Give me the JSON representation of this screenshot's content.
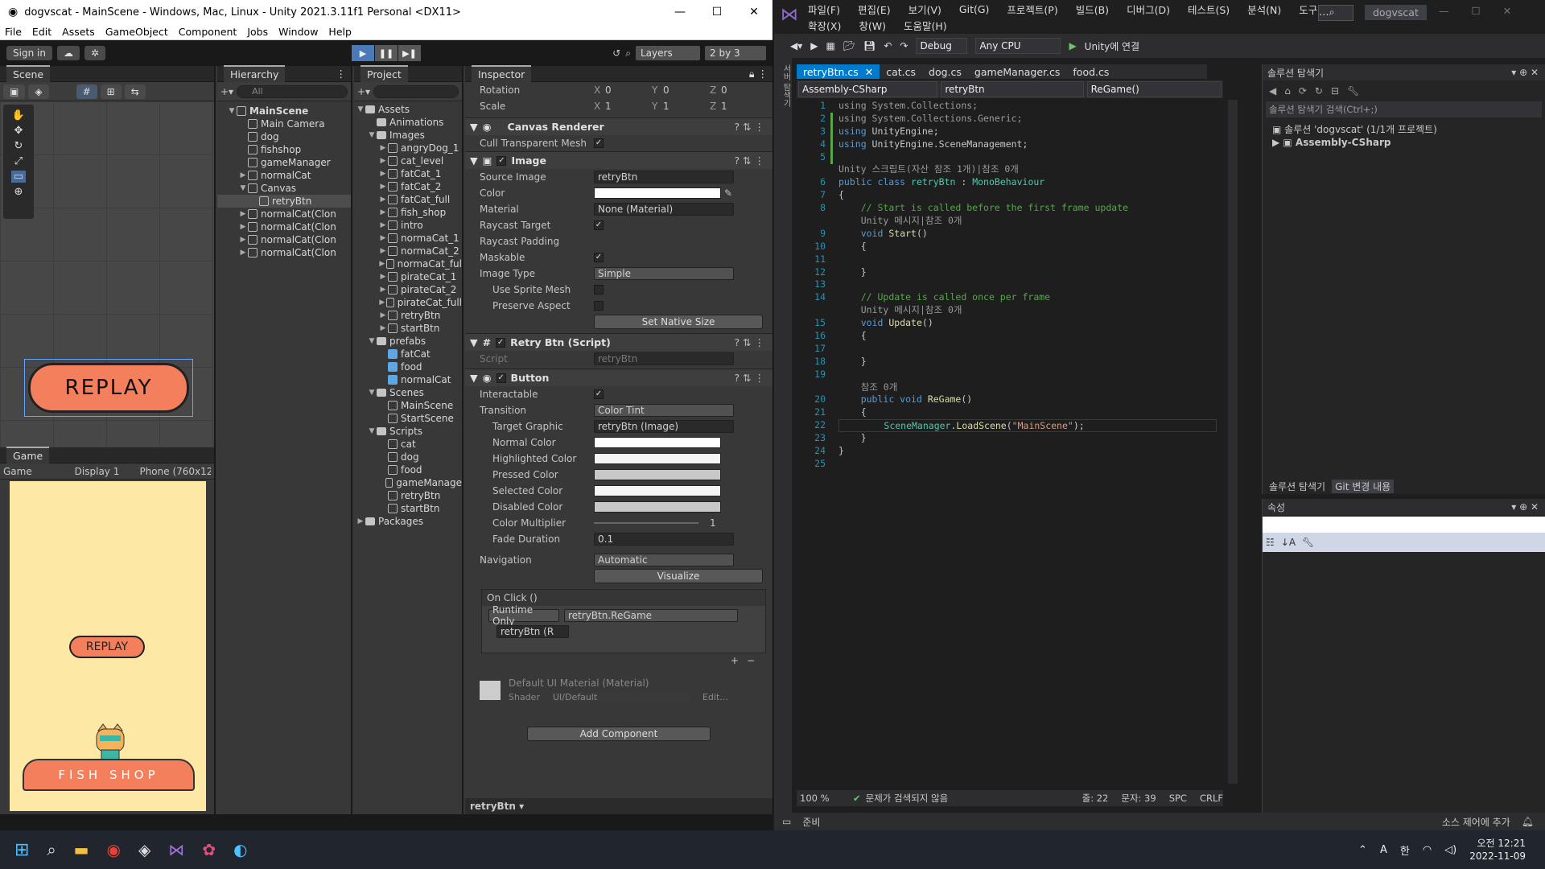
{
  "unity": {
    "title": "dogvscat - MainScene - Windows, Mac, Linux - Unity 2021.3.11f1 Personal <DX11>",
    "menu": [
      "File",
      "Edit",
      "Assets",
      "GameObject",
      "Component",
      "Jobs",
      "Window",
      "Help"
    ],
    "toolbar": {
      "signin": "Sign in",
      "layers": "Layers",
      "layout": "2 by 3"
    },
    "scene": {
      "tab": "Scene",
      "button_text": "REPLAY"
    },
    "game": {
      "tab": "Game",
      "display": "Game",
      "display_num": "Display 1",
      "resolution": "Phone (760x128",
      "replay": "REPLAY",
      "shop": "FISH  SHOP"
    },
    "hierarchy": {
      "tab": "Hierarchy",
      "search": "All",
      "items": [
        {
          "label": "MainScene",
          "depth": 0,
          "arrow": "▼",
          "bold": true
        },
        {
          "label": "Main Camera",
          "depth": 1,
          "arrow": ""
        },
        {
          "label": "dog",
          "depth": 1,
          "arrow": ""
        },
        {
          "label": "fishshop",
          "depth": 1,
          "arrow": ""
        },
        {
          "label": "gameManager",
          "depth": 1,
          "arrow": ""
        },
        {
          "label": "normalCat",
          "depth": 1,
          "arrow": "▶"
        },
        {
          "label": "Canvas",
          "depth": 1,
          "arrow": "▼"
        },
        {
          "label": "retryBtn",
          "depth": 2,
          "arrow": "",
          "selected": true
        },
        {
          "label": "normalCat(Clon",
          "depth": 1,
          "arrow": "▶"
        },
        {
          "label": "normalCat(Clon",
          "depth": 1,
          "arrow": "▶"
        },
        {
          "label": "normalCat(Clon",
          "depth": 1,
          "arrow": "▶"
        },
        {
          "label": "normalCat(Clon",
          "depth": 1,
          "arrow": "▶"
        }
      ]
    },
    "project": {
      "tab": "Project",
      "items": [
        {
          "label": "Assets",
          "depth": 0,
          "arrow": "▼",
          "type": "folder"
        },
        {
          "label": "Animations",
          "depth": 1,
          "arrow": "",
          "type": "folder"
        },
        {
          "label": "Images",
          "depth": 1,
          "arrow": "▼",
          "type": "folder"
        },
        {
          "label": "angryDog_1",
          "depth": 2,
          "arrow": "▶",
          "type": "img"
        },
        {
          "label": "cat_level",
          "depth": 2,
          "arrow": "▶",
          "type": "img"
        },
        {
          "label": "fatCat_1",
          "depth": 2,
          "arrow": "▶",
          "type": "img"
        },
        {
          "label": "fatCat_2",
          "depth": 2,
          "arrow": "▶",
          "type": "img"
        },
        {
          "label": "fatCat_full",
          "depth": 2,
          "arrow": "▶",
          "type": "img"
        },
        {
          "label": "fish_shop",
          "depth": 2,
          "arrow": "▶",
          "type": "img"
        },
        {
          "label": "intro",
          "depth": 2,
          "arrow": "▶",
          "type": "img"
        },
        {
          "label": "normaCat_1",
          "depth": 2,
          "arrow": "▶",
          "type": "img"
        },
        {
          "label": "normaCat_2",
          "depth": 2,
          "arrow": "▶",
          "type": "img"
        },
        {
          "label": "normaCat_ful",
          "depth": 2,
          "arrow": "▶",
          "type": "img"
        },
        {
          "label": "pirateCat_1",
          "depth": 2,
          "arrow": "▶",
          "type": "img"
        },
        {
          "label": "pirateCat_2",
          "depth": 2,
          "arrow": "▶",
          "type": "img"
        },
        {
          "label": "pirateCat_full",
          "depth": 2,
          "arrow": "▶",
          "type": "img"
        },
        {
          "label": "retryBtn",
          "depth": 2,
          "arrow": "▶",
          "type": "img"
        },
        {
          "label": "startBtn",
          "depth": 2,
          "arrow": "▶",
          "type": "img"
        },
        {
          "label": "prefabs",
          "depth": 1,
          "arrow": "▼",
          "type": "folder"
        },
        {
          "label": "fatCat",
          "depth": 2,
          "arrow": "",
          "type": "prefab"
        },
        {
          "label": "food",
          "depth": 2,
          "arrow": "",
          "type": "prefab"
        },
        {
          "label": "normalCat",
          "depth": 2,
          "arrow": "",
          "type": "prefab"
        },
        {
          "label": "Scenes",
          "depth": 1,
          "arrow": "▼",
          "type": "folder"
        },
        {
          "label": "MainScene",
          "depth": 2,
          "arrow": "",
          "type": "scene"
        },
        {
          "label": "StartScene",
          "depth": 2,
          "arrow": "",
          "type": "scene"
        },
        {
          "label": "Scripts",
          "depth": 1,
          "arrow": "▼",
          "type": "folder"
        },
        {
          "label": "cat",
          "depth": 2,
          "arrow": "",
          "type": "script"
        },
        {
          "label": "dog",
          "depth": 2,
          "arrow": "",
          "type": "script"
        },
        {
          "label": "food",
          "depth": 2,
          "arrow": "",
          "type": "script"
        },
        {
          "label": "gameManage",
          "depth": 2,
          "arrow": "",
          "type": "script"
        },
        {
          "label": "retryBtn",
          "depth": 2,
          "arrow": "",
          "type": "script"
        },
        {
          "label": "startBtn",
          "depth": 2,
          "arrow": "",
          "type": "script"
        },
        {
          "label": "Packages",
          "depth": 0,
          "arrow": "▶",
          "type": "folder"
        }
      ]
    },
    "inspector": {
      "tab": "Inspector",
      "rotation": {
        "label": "Rotation",
        "x": "0",
        "y": "0",
        "z": "0"
      },
      "scale": {
        "label": "Scale",
        "x": "1",
        "y": "1",
        "z": "1"
      },
      "canvas_renderer": {
        "title": "Canvas Renderer",
        "cull_label": "Cull Transparent Mesh"
      },
      "image": {
        "title": "Image",
        "source_label": "Source Image",
        "source": "retryBtn",
        "color_label": "Color",
        "material_label": "Material",
        "material": "None (Material)",
        "raycast_label": "Raycast Target",
        "padding_label": "Raycast Padding",
        "maskable_label": "Maskable",
        "type_label": "Image Type",
        "type": "Simple",
        "sprite_mesh_label": "Use Sprite Mesh",
        "aspect_label": "Preserve Aspect",
        "native_btn": "Set Native Size"
      },
      "script": {
        "title": "Retry Btn (Script)",
        "label": "Script",
        "value": "retryBtn"
      },
      "button": {
        "title": "Button",
        "interactable_label": "Interactable",
        "transition_label": "Transition",
        "transition": "Color Tint",
        "target_label": "Target Graphic",
        "target": "retryBtn (Image)",
        "normal": "Normal Color",
        "highlighted": "Highlighted Color",
        "pressed": "Pressed Color",
        "selected": "Selected Color",
        "disabled": "Disabled Color",
        "multiplier_label": "Color Multiplier",
        "multiplier": "1",
        "fade_label": "Fade Duration",
        "fade": "0.1",
        "nav_label": "Navigation",
        "nav": "Automatic",
        "visualize": "Visualize",
        "onclick": "On Click ()",
        "runtime": "Runtime Only",
        "func": "retryBtn.ReGame",
        "obj": "retryBtn (R"
      },
      "material": {
        "title": "Default UI Material (Material)",
        "shader_label": "Shader",
        "shader": "UI/Default",
        "edit": "Edit..."
      },
      "add_component": "Add Component",
      "footer": "retryBtn"
    }
  },
  "vs": {
    "menu_row1": [
      "파일(F)",
      "편집(E)",
      "보기(V)",
      "Git(G)",
      "프로젝트(P)",
      "빌드(B)",
      "디버그(D)",
      "테스트(S)",
      "분석(N)",
      "도구(T)"
    ],
    "menu_row2": [
      "확장(X)",
      "창(W)",
      "도움말(H)"
    ],
    "project_name": "dogvscat",
    "config": "Debug",
    "platform": "Any CPU",
    "run": "Unity에 연결",
    "tabs": [
      "retryBtn.cs",
      "cat.cs",
      "dog.cs",
      "gameManager.cs",
      "food.cs"
    ],
    "nav": {
      "project": "Assembly-CSharp",
      "class": "retryBtn",
      "member": "ReGame()"
    },
    "code": {
      "l1": "using System.Collections;",
      "l2": "using System.Collections.Generic;",
      "l3a": "using",
      "l3b": " UnityEngine;",
      "l4a": "using",
      "l4b": " UnityEngine.SceneManagement;",
      "hint6": "Unity 스크립트(자산 참조 1개)|참조 0개",
      "l6a": "public class",
      "l6b": "retryBtn",
      "l6c": "MonoBehaviour",
      "l8": "// Start is called before the first frame update",
      "hint9": "Unity 메시지|참조 0개",
      "l9a": "void",
      "l9b": "Start",
      "l14": "// Update is called once per frame",
      "hint15": "Unity 메시지|참조 0개",
      "l15a": "void",
      "l15b": "Update",
      "hint20": "참조 0개",
      "l20a": "public void",
      "l20b": "ReGame",
      "l22a": "SceneManager",
      "l22b": "LoadScene",
      "l22c": "\"MainScene\""
    },
    "status": {
      "zoom": "100 %",
      "issues": "문제가 검색되지 않음",
      "line": "줄: 22",
      "col": "문자: 39",
      "spc": "SPC",
      "crlf": "CRLF",
      "ready": "준비",
      "source": "소스 제어에 추가"
    },
    "solution": {
      "title": "솔루션 탐색기",
      "search": "솔루션 탐색기 검색(Ctrl+;)",
      "root": "솔루션 'dogvscat' (1/1개 프로젝트)",
      "project": "Assembly-CSharp",
      "tab1": "솔루션 탐색기",
      "tab2": "Git 변경 내용"
    },
    "props": {
      "title": "속성"
    }
  },
  "taskbar": {
    "time": "오전 12:21",
    "date": "2022-11-09",
    "ime": "한",
    "lang": "A"
  }
}
